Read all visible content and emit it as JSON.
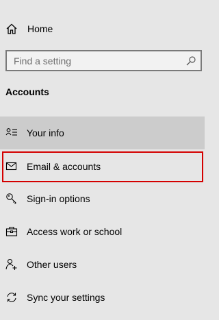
{
  "home": {
    "label": "Home",
    "icon": "home-icon"
  },
  "search": {
    "placeholder": "Find a setting",
    "value": "",
    "icon": "search-icon"
  },
  "section": {
    "title": "Accounts"
  },
  "nav": {
    "items": [
      {
        "label": "Your info",
        "icon": "person-list-icon",
        "selected": true
      },
      {
        "label": "Email & accounts",
        "icon": "mail-icon",
        "selected": false,
        "highlighted": true
      },
      {
        "label": "Sign-in options",
        "icon": "key-icon",
        "selected": false
      },
      {
        "label": "Access work or school",
        "icon": "briefcase-icon",
        "selected": false
      },
      {
        "label": "Other users",
        "icon": "add-person-icon",
        "selected": false
      },
      {
        "label": "Sync your settings",
        "icon": "sync-icon",
        "selected": false
      }
    ]
  },
  "colors": {
    "background": "#e6e6e6",
    "selected_background": "#cccccc",
    "highlight_border": "#d40000",
    "search_border": "#7a7a7a"
  }
}
